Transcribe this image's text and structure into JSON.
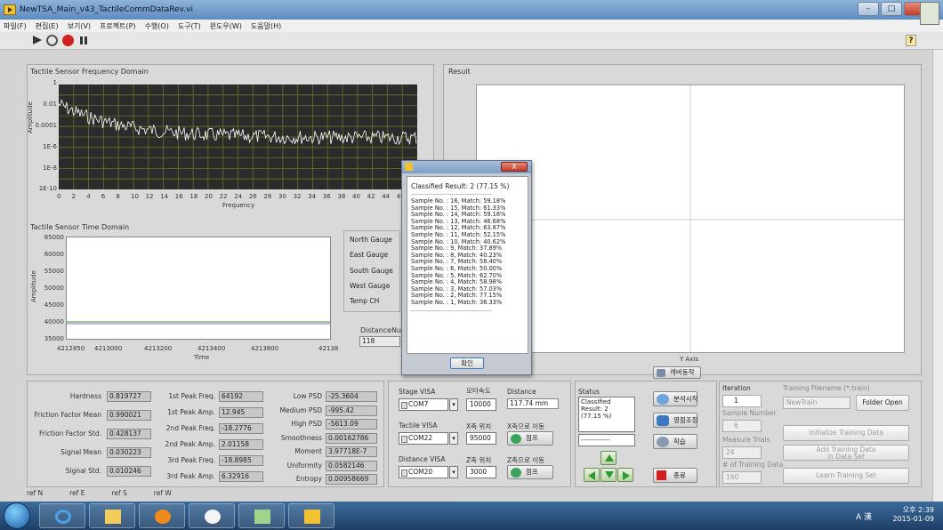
{
  "window": {
    "title": "NewTSA_Main_v43_TactileCommDataRev.vi",
    "controls": {
      "minimize": "–",
      "maximize": "□",
      "close": "X"
    }
  },
  "menu": [
    "파일(F)",
    "편집(E)",
    "보기(V)",
    "프로젝트(P)",
    "수행(O)",
    "도구(T)",
    "윈도우(W)",
    "도움말(H)"
  ],
  "toolbar": {
    "help": "?"
  },
  "freq_plot": {
    "title": "Tactile Sensor Frequency Domain",
    "ylabel": "Amplitude",
    "xlabel": "Frequency",
    "yticks": [
      "1",
      "0.01",
      "0.0001",
      "1E-6",
      "1E-8",
      "1E-10"
    ],
    "xticks": [
      "0",
      "2",
      "4",
      "6",
      "8",
      "10",
      "12",
      "14",
      "16",
      "18",
      "20",
      "22",
      "24",
      "26",
      "28",
      "30",
      "32",
      "34",
      "36",
      "38",
      "40",
      "42",
      "44",
      "46",
      "4"
    ]
  },
  "time_plot": {
    "title": "Tactile Sensor Time Domain",
    "ylabel": "Amplitude",
    "xlabel": "Time",
    "yticks": [
      "65000",
      "60000",
      "55000",
      "50000",
      "45000",
      "40000",
      "35000"
    ],
    "xticks": [
      "4212850",
      "4213000",
      "4213200",
      "4213400",
      "4213600",
      "42138"
    ]
  },
  "gauges": {
    "rows": [
      "North Gauge",
      "East Gauge",
      "South Gauge",
      "West Gauge",
      "Temp CH"
    ],
    "distance_label": "DistanceNu",
    "distance_value": "118"
  },
  "result_plot": {
    "title": "Result",
    "xlabel": "Y Axis",
    "legend_btn": "캐버동작"
  },
  "dialog": {
    "header": "Classified Result: 2 (77.15 %)",
    "rule": "------------------------------------------",
    "lines": [
      "Sample No. : 16, Match: 59.18%",
      "Sample No. : 15, Match: 61.33%",
      "Sample No. : 14, Match: 59.18%",
      "Sample No. : 13, Match: 46.68%",
      "Sample No. : 12, Match: 63.87%",
      "Sample No. : 11, Match: 52.15%",
      "Sample No. : 10, Match: 40.62%",
      "Sample No. : 9, Match: 37.89%",
      "Sample No. : 8, Match: 40.23%",
      "Sample No. : 7, Match: 58.40%",
      "Sample No. : 6, Match: 50.00%",
      "Sample No. : 5, Match: 62.70%",
      "Sample No. : 4, Match: 58.98%",
      "Sample No. : 3, Match: 57.03%",
      "Sample No. : 2, Match: 77.15%",
      "Sample No. : 1, Match: 36.33%"
    ],
    "ok": "확인",
    "close": "X"
  },
  "features": {
    "col1": [
      {
        "label": "Hardness",
        "value": "0.819727"
      },
      {
        "label": "Friction Factor Mean",
        "value": "0.990021"
      },
      {
        "label": "Friction Factor Std.",
        "value": "0.428137"
      },
      {
        "label": "Signal Mean",
        "value": "0.030223"
      },
      {
        "label": "Signal Std.",
        "value": "0.010246"
      }
    ],
    "col2": [
      {
        "label": "1st Peak Freq.",
        "value": "64192"
      },
      {
        "label": "1st Peak Amp.",
        "value": "12.945"
      },
      {
        "label": "2nd Peak Freq.",
        "value": "-18.2776"
      },
      {
        "label": "2nd Peak Amp.",
        "value": "2.01158"
      },
      {
        "label": "3rd Peak Freq.",
        "value": "-18.8985"
      },
      {
        "label": "3rd Peak Amp.",
        "value": "6.32916"
      }
    ],
    "col3": [
      {
        "label": "Low PSD",
        "value": "-25.3604"
      },
      {
        "label": "Medium PSD",
        "value": "-995.42"
      },
      {
        "label": "High PSD",
        "value": "-5613.09"
      },
      {
        "label": "Smoothness",
        "value": "0.00162786"
      },
      {
        "label": "Moment",
        "value": "3.97718E-7"
      },
      {
        "label": "Uniformity",
        "value": "0.0582146"
      },
      {
        "label": "Entropy",
        "value": "0.00958669"
      }
    ]
  },
  "comm": {
    "stage_visa_label": "Stage VISA",
    "stage_visa": "COM7",
    "tactile_visa_label": "Tactile VISA",
    "tactile_visa": "COM22",
    "distance_visa_label": "Distance VISA",
    "distance_visa": "COM20",
    "motor_speed_label": "모터속도",
    "motor_speed": "10000",
    "x_pos_label": "X축 위치",
    "x_pos": "95000",
    "z_pos_label": "Z축 위치",
    "z_pos": "3000",
    "distance_label": "Distance",
    "distance_value": "117.74 mm",
    "x_move_label": "X축으로 이동",
    "z_move_label": "Z축으로 이동",
    "x_go": "점프",
    "z_go": "점프"
  },
  "status": {
    "label": "Status",
    "box_lines": [
      "Classified",
      "Result: 2",
      "(77.15 %)"
    ],
    "box2": "-------------"
  },
  "actions": {
    "analyze": "분석시작",
    "calibrate": "영점조정",
    "learn": "학습",
    "stop": "종료"
  },
  "training": {
    "iteration_label": "Iteration",
    "iteration": "1",
    "filename_label": "Training Filename (*.train)",
    "filename": "NewTrain",
    "folder_open": "Folder Open",
    "sample_number_label": "Sample Number",
    "sample_number": "6",
    "measure_trials_label": "Measure Trials",
    "measure_trials": "24",
    "num_training_label": "# of Training Data",
    "num_training": "160",
    "init_btn": "Initialize Training Data",
    "add_btn_1": "Add Training Data",
    "add_btn_2": "in Data Set",
    "learn_btn": "Learn Training Set"
  },
  "refs": [
    "ref N",
    "ref E",
    "ref S",
    "ref W"
  ],
  "taskbar": {
    "time": "오후 2:39",
    "date": "2015-01-09",
    "tray": "A 漢"
  },
  "colors": {
    "plot_grid": "#6f6f2a",
    "freq_trace": "#ffffff",
    "titlebar": "#5d8cc0"
  }
}
